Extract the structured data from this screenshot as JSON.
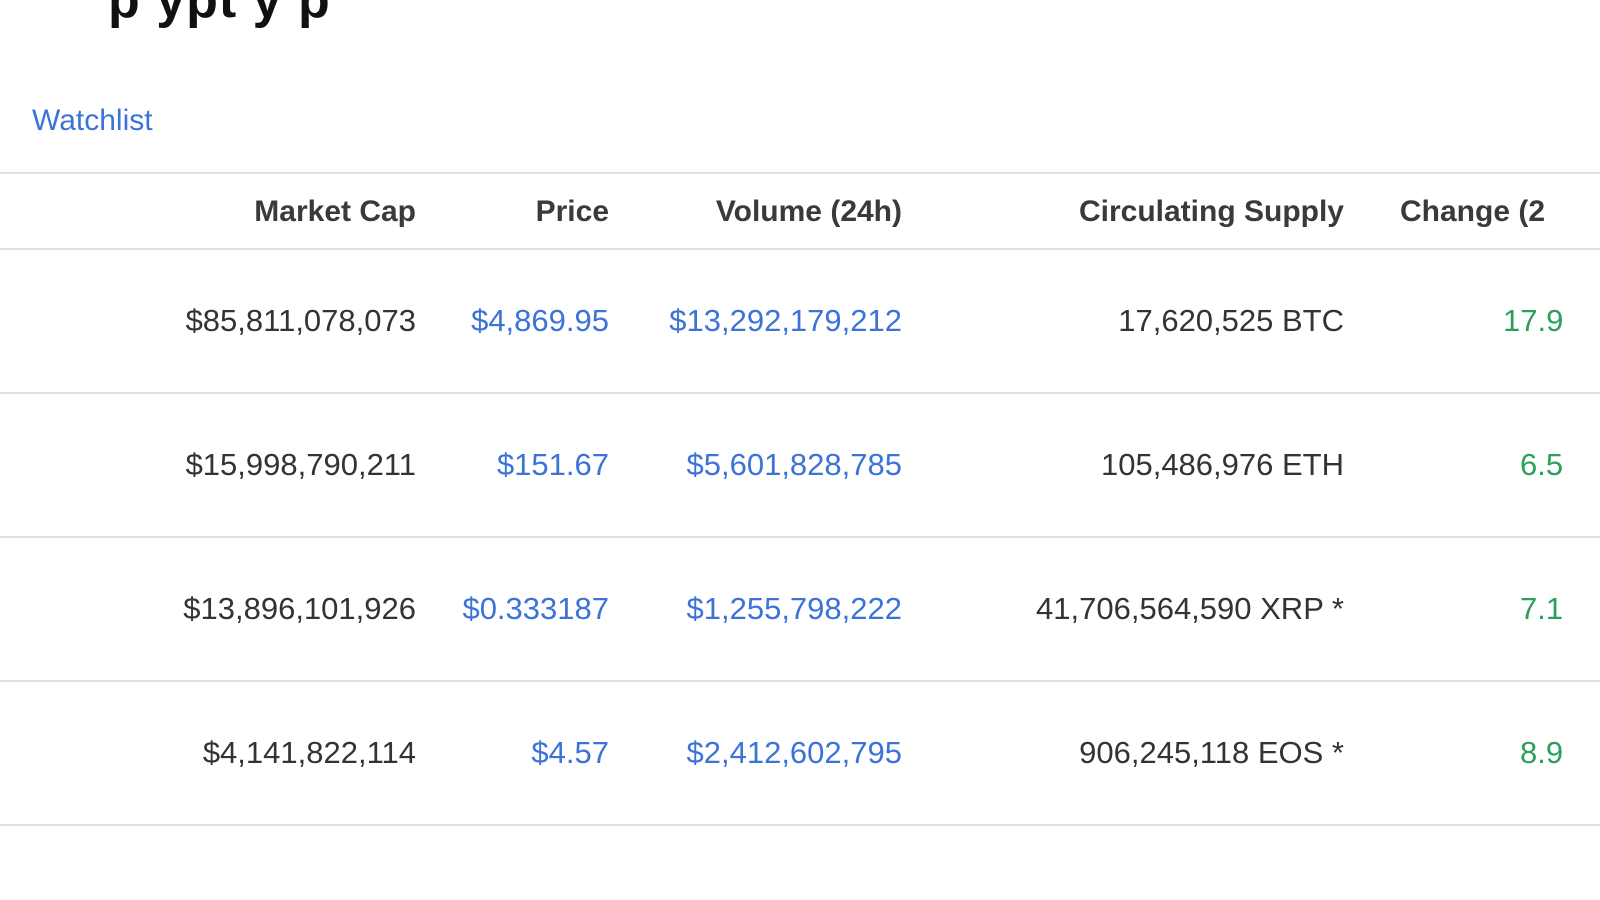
{
  "page": {
    "heading_fragment": "p  ypt        y        p",
    "watchlist_label": "Watchlist"
  },
  "table": {
    "headers": {
      "market_cap": "Market Cap",
      "price": "Price",
      "volume": "Volume (24h)",
      "supply": "Circulating Supply",
      "change": "Change (2"
    },
    "rows": [
      {
        "market_cap": "$85,811,078,073",
        "price": "$4,869.95",
        "volume": "$13,292,179,212",
        "supply": "17,620,525 BTC",
        "change": "17.9"
      },
      {
        "market_cap": "$15,998,790,211",
        "price": "$151.67",
        "volume": "$5,601,828,785",
        "supply": "105,486,976 ETH",
        "change": "6.5"
      },
      {
        "market_cap": "$13,896,101,926",
        "price": "$0.333187",
        "volume": "$1,255,798,222",
        "supply": "41,706,564,590 XRP *",
        "change": "7.1"
      },
      {
        "market_cap": "$4,141,822,114",
        "price": "$4.57",
        "volume": "$2,412,602,795",
        "supply": "906,245,118 EOS *",
        "change": "8.9"
      }
    ]
  },
  "colors": {
    "link": "#3b73d9",
    "positive": "#2e9e5b",
    "text": "#333333",
    "divider": "#e2e2e2"
  }
}
